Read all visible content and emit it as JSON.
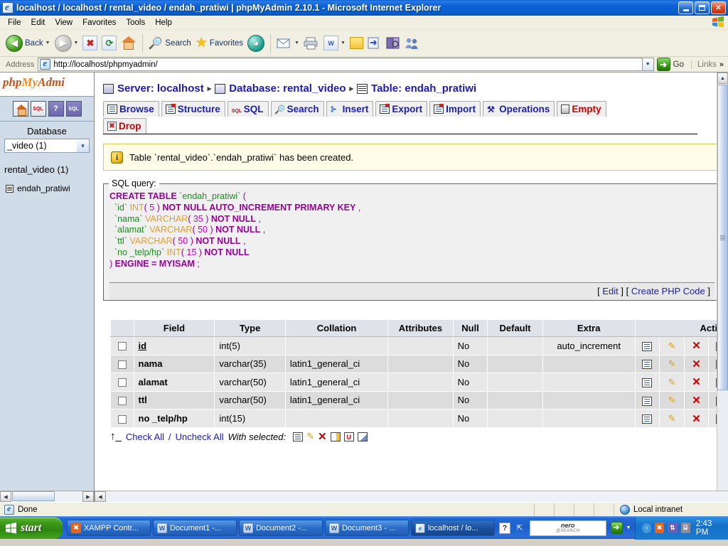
{
  "window": {
    "title": "localhost / localhost / rental_video / endah_pratiwi  |  phpMyAdmin 2.10.1 - Microsoft Internet Explorer",
    "title_icon": "ie-document-icon",
    "minimize": "minimize-button",
    "restore": "restore-button",
    "close": "close-button"
  },
  "menubar": {
    "items": [
      "File",
      "Edit",
      "View",
      "Favorites",
      "Tools",
      "Help"
    ]
  },
  "toolbar": {
    "back": "Back",
    "search": "Search",
    "favorites": "Favorites"
  },
  "addressbar": {
    "label": "Address",
    "url": "http://localhost/phpmyadmin/",
    "go": "Go",
    "links": "Links"
  },
  "sidebar": {
    "logo": {
      "php": "php",
      "my": "My",
      "admin": "Admi"
    },
    "icons": [
      "home-icon",
      "sql-query-icon",
      "documentation-icon",
      "sql-help-icon"
    ],
    "database_label": "Database",
    "database_selected": "_video (1)",
    "database_name": "rental_video (1)",
    "tables": [
      "endah_pratiwi"
    ]
  },
  "breadcrumb": {
    "server_label": "Server: localhost",
    "database_label": "Database: rental_video",
    "table_label": "Table: endah_pratiwi",
    "separator": "▸"
  },
  "tabs": [
    {
      "label": "Browse",
      "icon": "browse-icon",
      "danger": false
    },
    {
      "label": "Structure",
      "icon": "structure-icon",
      "danger": false
    },
    {
      "label": "SQL",
      "icon": "sql-icon",
      "danger": false
    },
    {
      "label": "Search",
      "icon": "search-icon",
      "danger": false
    },
    {
      "label": "Insert",
      "icon": "insert-icon",
      "danger": false
    },
    {
      "label": "Export",
      "icon": "export-icon",
      "danger": false
    },
    {
      "label": "Import",
      "icon": "import-icon",
      "danger": false
    },
    {
      "label": "Operations",
      "icon": "operations-icon",
      "danger": false
    },
    {
      "label": "Empty",
      "icon": "empty-icon",
      "danger": true
    },
    {
      "label": "Drop",
      "icon": "drop-icon",
      "danger": true
    }
  ],
  "notice": {
    "icon": "info-icon",
    "text": "Table `rental_video`.`endah_pratiwi` has been created."
  },
  "sql_query": {
    "legend": "SQL query:",
    "lines": [
      [
        {
          "t": "CREATE TABLE ",
          "c": "k"
        },
        {
          "t": "`endah_pratiwi`",
          "c": "id"
        },
        {
          "t": " (",
          "c": "p"
        }
      ],
      [
        {
          "t": "  `id` ",
          "c": "id"
        },
        {
          "t": "INT",
          "c": "ty"
        },
        {
          "t": "( ",
          "c": "p"
        },
        {
          "t": "5",
          "c": "n"
        },
        {
          "t": " ) ",
          "c": "p"
        },
        {
          "t": "NOT NULL AUTO_INCREMENT PRIMARY KEY",
          "c": "k"
        },
        {
          "t": " ,",
          "c": "p"
        }
      ],
      [
        {
          "t": "  `nama` ",
          "c": "id"
        },
        {
          "t": "VARCHAR",
          "c": "ty"
        },
        {
          "t": "( ",
          "c": "p"
        },
        {
          "t": "35",
          "c": "n"
        },
        {
          "t": " ) ",
          "c": "p"
        },
        {
          "t": "NOT NULL",
          "c": "k"
        },
        {
          "t": " ,",
          "c": "p"
        }
      ],
      [
        {
          "t": "  `alamat` ",
          "c": "id"
        },
        {
          "t": "VARCHAR",
          "c": "ty"
        },
        {
          "t": "( ",
          "c": "p"
        },
        {
          "t": "50",
          "c": "n"
        },
        {
          "t": " ) ",
          "c": "p"
        },
        {
          "t": "NOT NULL",
          "c": "k"
        },
        {
          "t": " ,",
          "c": "p"
        }
      ],
      [
        {
          "t": "  `ttl` ",
          "c": "id"
        },
        {
          "t": "VARCHAR",
          "c": "ty"
        },
        {
          "t": "( ",
          "c": "p"
        },
        {
          "t": "50",
          "c": "n"
        },
        {
          "t": " ) ",
          "c": "p"
        },
        {
          "t": "NOT NULL",
          "c": "k"
        },
        {
          "t": " ,",
          "c": "p"
        }
      ],
      [
        {
          "t": "  `no _telp/hp` ",
          "c": "id"
        },
        {
          "t": "INT",
          "c": "ty"
        },
        {
          "t": "( ",
          "c": "p"
        },
        {
          "t": "15",
          "c": "n"
        },
        {
          "t": " ) ",
          "c": "p"
        },
        {
          "t": "NOT NULL",
          "c": "k"
        }
      ],
      [
        {
          "t": ") ",
          "c": "p"
        },
        {
          "t": "ENGINE = MYISAM",
          "c": "k"
        },
        {
          "t": " ;",
          "c": "p"
        }
      ]
    ],
    "actions": {
      "edit": "Edit",
      "create_php": "Create PHP Code",
      "bracket_open": "[",
      "bracket_close": "]"
    }
  },
  "structure": {
    "headers": [
      "",
      "Field",
      "Type",
      "Collation",
      "Attributes",
      "Null",
      "Default",
      "Extra",
      "Action"
    ],
    "rows": [
      {
        "field": "id",
        "primary": true,
        "type": "int(5)",
        "collation": "",
        "attributes": "",
        "null": "No",
        "default": "",
        "extra": "auto_increment"
      },
      {
        "field": "nama",
        "primary": false,
        "type": "varchar(35)",
        "collation": "latin1_general_ci",
        "attributes": "",
        "null": "No",
        "default": "",
        "extra": ""
      },
      {
        "field": "alamat",
        "primary": false,
        "type": "varchar(50)",
        "collation": "latin1_general_ci",
        "attributes": "",
        "null": "No",
        "default": "",
        "extra": ""
      },
      {
        "field": "ttl",
        "primary": false,
        "type": "varchar(50)",
        "collation": "latin1_general_ci",
        "attributes": "",
        "null": "No",
        "default": "",
        "extra": ""
      },
      {
        "field": "no _telp/hp",
        "primary": false,
        "type": "int(15)",
        "collation": "",
        "attributes": "",
        "null": "No",
        "default": "",
        "extra": ""
      }
    ],
    "row_action_icons": [
      "browse-icon",
      "edit-pencil-icon",
      "drop-x-icon",
      "primary-key-icon"
    ]
  },
  "check_all": {
    "check_all": "Check All",
    "divider": "/",
    "uncheck_all": "Uncheck All",
    "with_selected": "With selected:",
    "icons": [
      "browse-icon",
      "edit-pencil-icon",
      "drop-x-icon",
      "primary-key-icon",
      "unique-icon",
      "index-icon"
    ]
  },
  "statusbar": {
    "status": "Done",
    "zone": "Local intranet"
  },
  "taskbar": {
    "start": "start",
    "items": [
      {
        "label": "XAMPP Contr...",
        "icon": "xampp-icon",
        "active": false
      },
      {
        "label": "Document1 -...",
        "icon": "word-icon",
        "active": false
      },
      {
        "label": "Document2 -...",
        "icon": "word-icon",
        "active": false
      },
      {
        "label": "Document3 - ...",
        "icon": "word-icon",
        "active": false
      },
      {
        "label": "localhost / lo...",
        "icon": "ie-icon",
        "active": true
      }
    ],
    "nero": {
      "title": "nero",
      "subtitle": "@SEARCH"
    },
    "clock": "2:43 PM"
  },
  "colors": {
    "titlebar_blue": "#0b60d4",
    "link_blue": "#1c1cb0",
    "danger_red": "#cc0000",
    "notice_bg": "#fffde8",
    "notice_border": "#e0c84a",
    "sidebar_bg": "#d0dce7"
  }
}
